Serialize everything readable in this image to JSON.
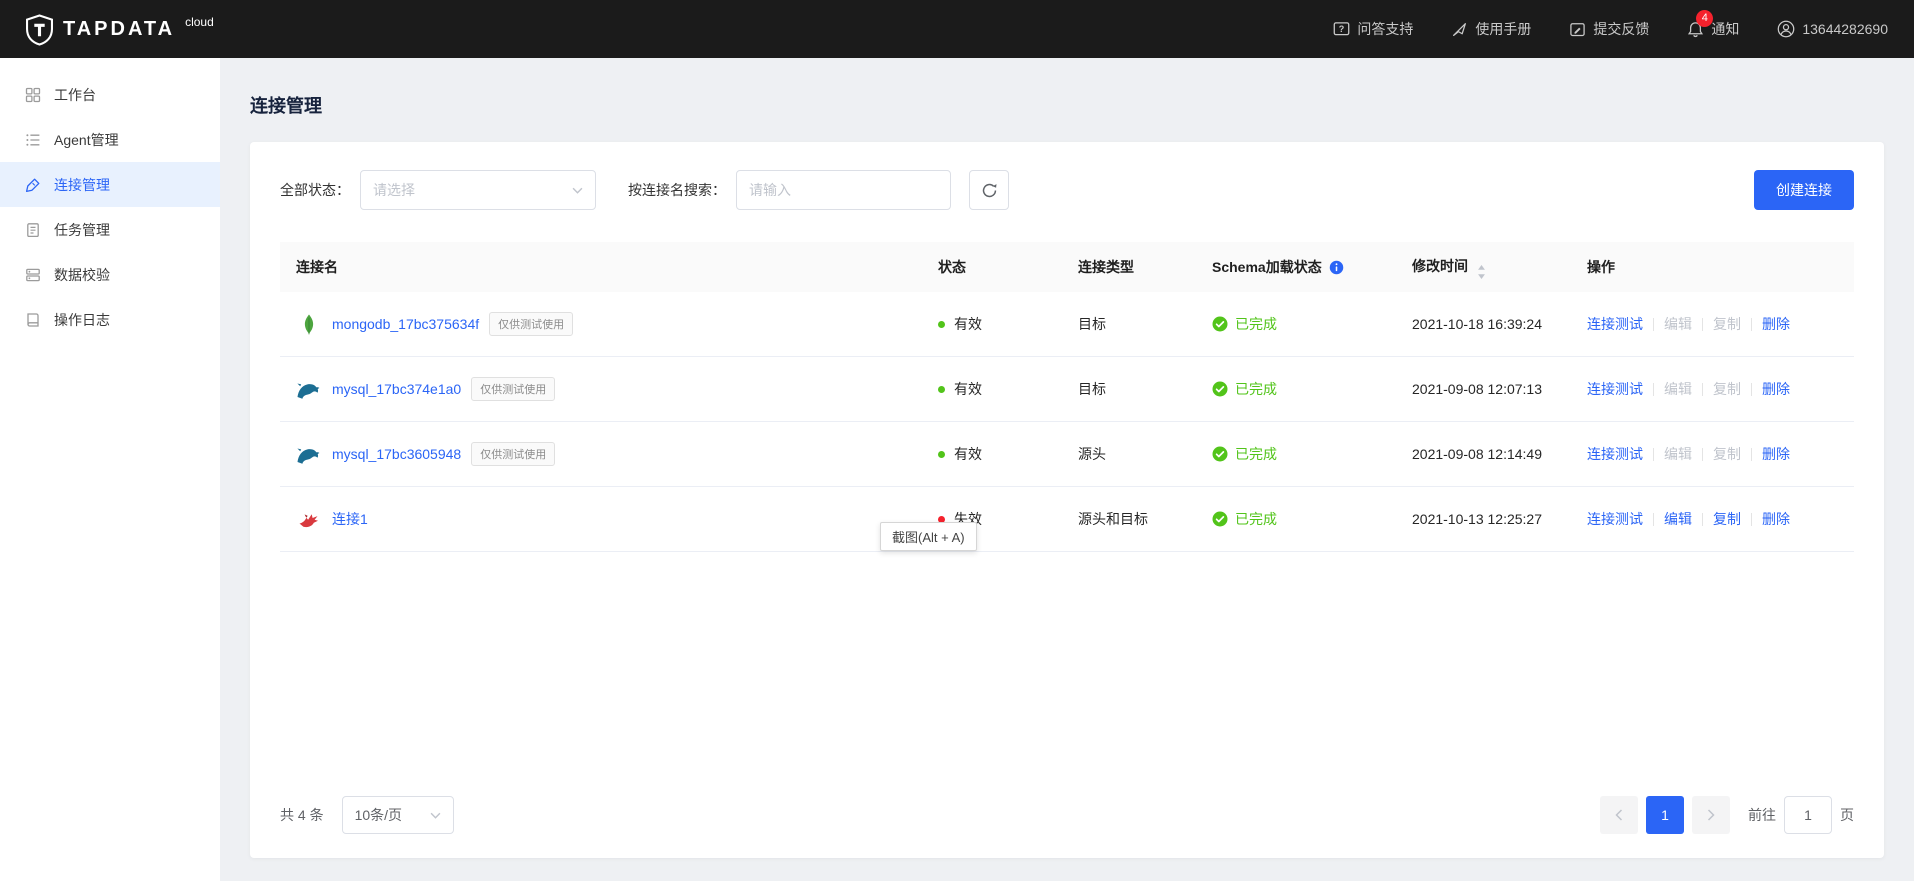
{
  "topbar": {
    "brand": "TAPDATA",
    "brand_suffix": "cloud",
    "nav": [
      {
        "label": "问答支持"
      },
      {
        "label": "使用手册"
      },
      {
        "label": "提交反馈"
      },
      {
        "label": "通知",
        "badge": "4"
      },
      {
        "label": "13644282690"
      }
    ]
  },
  "sidebar": {
    "items": [
      {
        "label": "工作台"
      },
      {
        "label": "Agent管理"
      },
      {
        "label": "连接管理",
        "active": true
      },
      {
        "label": "任务管理"
      },
      {
        "label": "数据校验"
      },
      {
        "label": "操作日志"
      }
    ]
  },
  "page": {
    "title": "连接管理"
  },
  "filters": {
    "status_label": "全部状态：",
    "status_placeholder": "请选择",
    "search_label": "按连接名搜索：",
    "search_placeholder": "请输入",
    "create_button": "创建连接"
  },
  "table": {
    "headers": {
      "name": "连接名",
      "status": "状态",
      "type": "连接类型",
      "schema": "Schema加载状态",
      "time": "修改时间",
      "ops": "操作"
    },
    "action_labels": {
      "test": "连接测试",
      "edit": "编辑",
      "copy": "复制",
      "delete": "删除"
    },
    "rows": [
      {
        "name": "mongodb_17bc375634f",
        "db": "mongodb",
        "badge": "仅供测试使用",
        "status": "有效",
        "type": "目标",
        "schema": "已完成",
        "time": "2021-10-18 16:39:24",
        "edit_disabled": true,
        "copy_disabled": true
      },
      {
        "name": "mysql_17bc374e1a0",
        "db": "mysql",
        "badge": "仅供测试使用",
        "status": "有效",
        "type": "目标",
        "schema": "已完成",
        "time": "2021-09-08 12:07:13",
        "edit_disabled": true,
        "copy_disabled": true
      },
      {
        "name": "mysql_17bc3605948",
        "db": "mysql",
        "badge": "仅供测试使用",
        "status": "有效",
        "type": "源头",
        "schema": "已完成",
        "time": "2021-09-08 12:14:49",
        "edit_disabled": true,
        "copy_disabled": true
      },
      {
        "name": "连接1",
        "db": "custom",
        "status": "失效",
        "type": "源头和目标",
        "schema": "已完成",
        "time": "2021-10-13 12:25:27",
        "edit_disabled": false,
        "copy_disabled": false
      }
    ]
  },
  "pagination": {
    "total": "共 4 条",
    "page_size": "10条/页",
    "current_page": "1",
    "goto_label": "前往",
    "goto_value": "1",
    "goto_unit": "页"
  },
  "overlay": {
    "tooltip": "截图(Alt + A)"
  },
  "colors": {
    "primary": "#2b65f6",
    "success": "#52c41a",
    "danger": "#f5222d",
    "topbar": "#1b1b1b"
  }
}
